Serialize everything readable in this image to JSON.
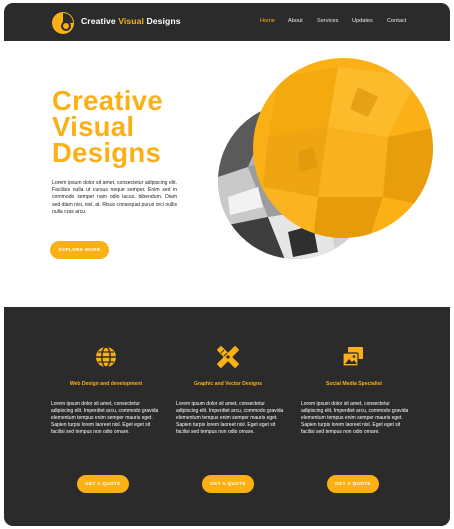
{
  "header": {
    "brand_prefix": "Creative ",
    "brand_accent": "Visual",
    "brand_suffix": " Designs",
    "nav": [
      {
        "label": "Home",
        "active": true
      },
      {
        "label": "About",
        "active": false
      },
      {
        "label": "Services",
        "active": false
      },
      {
        "label": "Updates",
        "active": false
      },
      {
        "label": "Contact",
        "active": false
      }
    ]
  },
  "hero": {
    "title_line1": "Creative",
    "title_line2": "Visual",
    "title_line3": "Designs",
    "body": "Lorem ipsum dolor sit amet, consectetur adipiscing elit. Facilisis nulla ut cursus neque semper. Enim sed in commodo semper nam odio lacus, bibendum. Diam sed diam nisi, nisl, at. Risus consequat purus orci nullis nulla cras arcu.",
    "button": "EXPLORE MORE"
  },
  "services": [
    {
      "icon": "globe-icon",
      "title": "Web Design and development",
      "body": "Lorem ipsum dolor sit amet, consectetur adipiscing elit. Imperdiet arcu, commodo gravida elementum tempus enim semper mauris eget. Sapien turpis lorem laoreet nisl. Eget eget sit facilisi sed tempus non odio ornare.",
      "button": "GET A QUOTE"
    },
    {
      "icon": "pencil-ruler-icon",
      "title": "Graphic and Vector Designs",
      "body": "Lorem ipsum dolor sit amet, consectetur adipiscing elit. Imperdiet arcu, commodo gravida elementum tempus enim semper mauris eget. Sapien turpis lorem laoreet nisl. Eget eget sit facilisi sed tempus non odio ornare.",
      "button": "GET A QUOTE"
    },
    {
      "icon": "photo-stack-icon",
      "title": "Social Media Specialist",
      "body": "Lorem ipsum dolor sit amet, consectetur adipiscing elit. Imperdiet arcu, commodo gravida elementum tempus enim semper mauris eget. Sapien turpis lorem laoreet nisl. Eget eget sit facilisi sed tempus non odio ornare.",
      "button": "GET A QUOTE"
    }
  ],
  "colors": {
    "accent": "#fbb116",
    "dark": "#2b2b2b",
    "text": "#222222"
  }
}
